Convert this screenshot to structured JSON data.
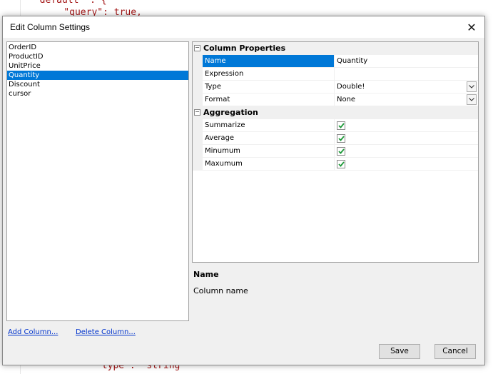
{
  "background_code": {
    "line1": "  default\" : {",
    "line2": "    \"query\": true,",
    "line3": "      \"type\": \"string\"",
    "key_color": "#a31515",
    "value_color": "#0000ff"
  },
  "dialog": {
    "title": "Edit Column Settings",
    "close_glyph": "✕"
  },
  "columns": [
    "OrderID",
    "ProductID",
    "UnitPrice",
    "Quantity",
    "Discount",
    "cursor"
  ],
  "selected_column": "Quantity",
  "property_grid": {
    "categories": [
      {
        "label": "Column Properties",
        "toggle": "⊟",
        "rows": [
          {
            "name": "Name",
            "value": "Quantity",
            "selected": true,
            "editor": "text"
          },
          {
            "name": "Expression",
            "value": "",
            "selected": false,
            "editor": "text"
          },
          {
            "name": "Type",
            "value": "Double!",
            "selected": false,
            "editor": "dropdown"
          },
          {
            "name": "Format",
            "value": "None",
            "selected": false,
            "editor": "dropdown"
          }
        ]
      },
      {
        "label": "Aggregation",
        "toggle": "⊟",
        "rows": [
          {
            "name": "Summarize",
            "checked": true,
            "editor": "checkbox"
          },
          {
            "name": "Average",
            "checked": true,
            "editor": "checkbox"
          },
          {
            "name": "Minumum",
            "checked": true,
            "editor": "checkbox"
          },
          {
            "name": "Maxumum",
            "checked": true,
            "editor": "checkbox"
          }
        ]
      }
    ]
  },
  "description": {
    "title": "Name",
    "text": "Column name"
  },
  "links": {
    "add": "Add Column...",
    "delete": "Delete Column..."
  },
  "buttons": {
    "save": "Save",
    "cancel": "Cancel"
  },
  "colors": {
    "selection": "#0078d7",
    "checkmark": "#1f9a3a",
    "link": "#0033cc"
  }
}
